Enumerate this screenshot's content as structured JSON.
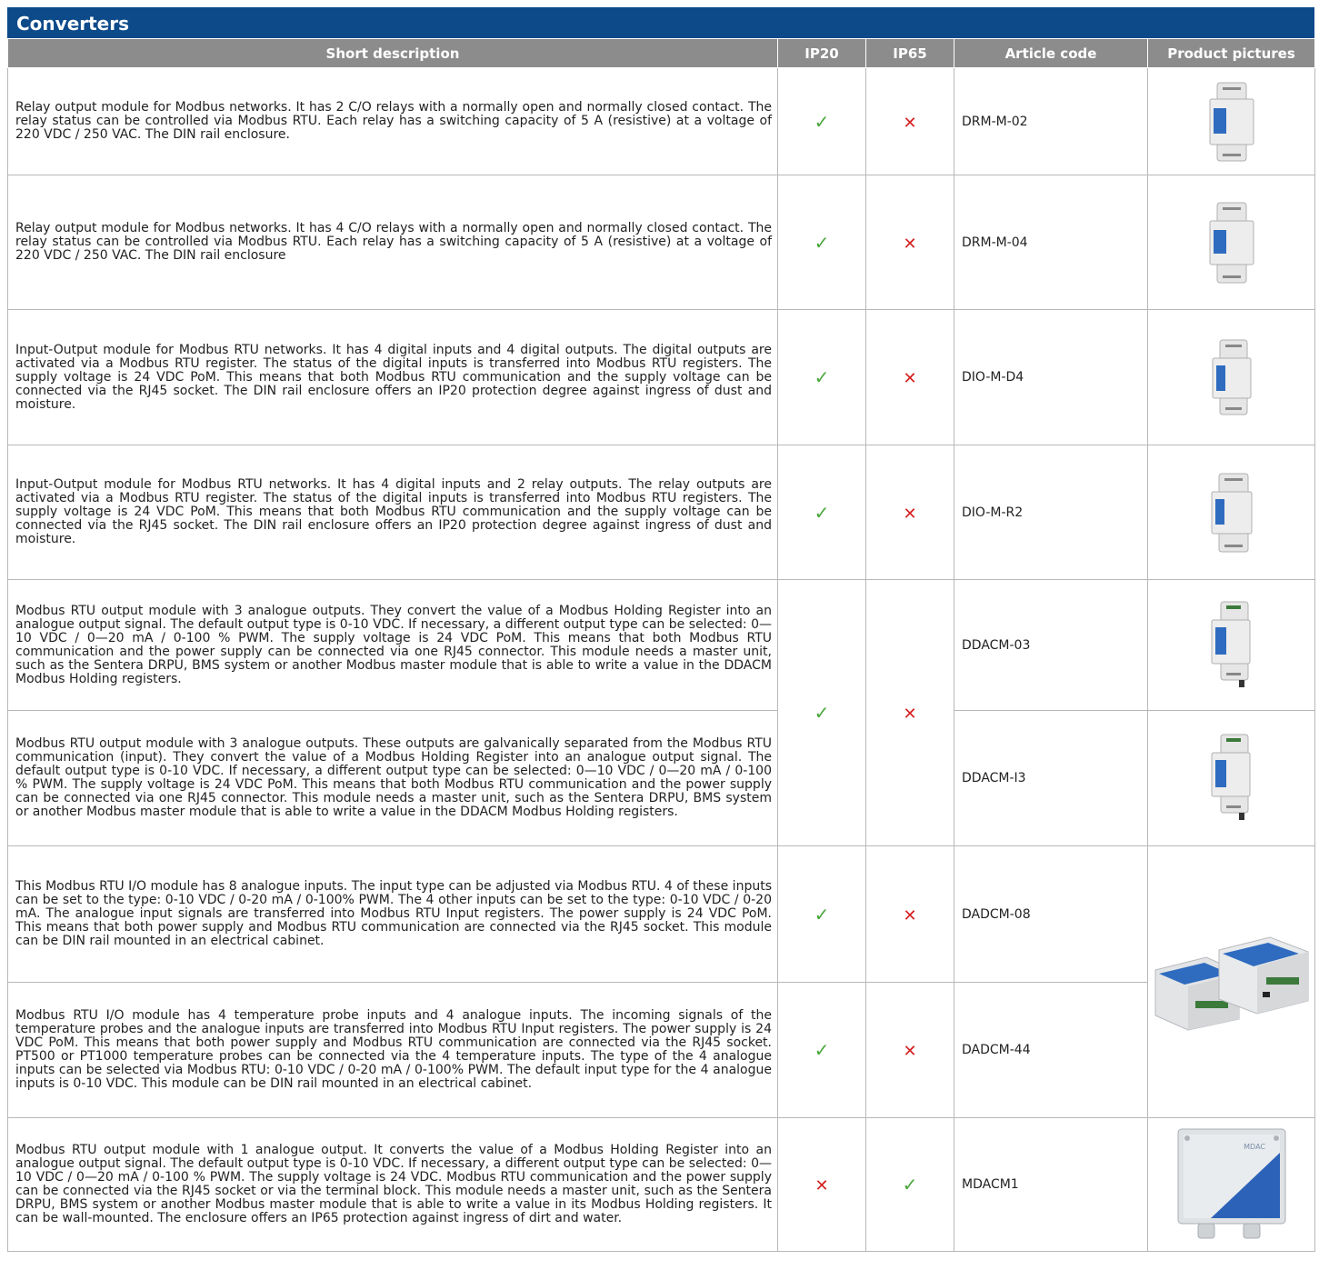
{
  "title": "Converters",
  "headers": {
    "desc": "Short description",
    "ip20": "IP20",
    "ip65": "IP65",
    "code": "Article code",
    "pictures": "Product pictures"
  },
  "symbols": {
    "check": "✓",
    "cross": "✕"
  },
  "colors": {
    "title_bg": "#0d4a8a",
    "header_bg": "#8c8c8c",
    "check": "#4aa63c",
    "cross": "#d62020"
  },
  "rows": [
    {
      "desc": "Relay output module for Modbus networks. It has 2 C/O relays with a normally open and normally closed contact. The relay status can be controlled via Modbus RTU. Each relay has a switching capacity of 5 A (resistive) at a voltage of 220 VDC / 250 VAC. The DIN rail enclosure.",
      "ip20": "check",
      "ip65": "cross",
      "code": "DRM-M-02",
      "picture": "din-rail-relay-module-picture"
    },
    {
      "desc": "Relay output module for Modbus networks. It has 4 C/O relays with a normally open and normally closed contact. The relay status can be controlled via Modbus RTU. Each relay has a switching capacity of 5 A (resistive) at a voltage of 220 VDC / 250 VAC. The DIN rail enclosure",
      "ip20": "check",
      "ip65": "cross",
      "code": "DRM-M-04",
      "picture": "din-rail-relay-module-picture"
    },
    {
      "desc": "Input-Output module for Modbus RTU networks. It has 4 digital inputs and 4 digital outputs. The digital outputs are activated via a Modbus RTU register. The status of the digital inputs is transferred into Modbus RTU registers. The supply voltage is 24 VDC PoM. This means that both Modbus RTU communication and the supply voltage can be connected via the RJ45 socket. The DIN rail enclosure offers an IP20 protection degree against ingress of dust and moisture.",
      "ip20": "check",
      "ip65": "cross",
      "code": "DIO-M-D4",
      "picture": "din-rail-io-module-picture"
    },
    {
      "desc": "Input-Output module for Modbus RTU networks. It has 4 digital inputs and 2 relay outputs. The relay outputs are activated via a Modbus RTU register. The status of the digital inputs is transferred into Modbus RTU registers. The supply voltage is 24 VDC PoM. This means that both Modbus RTU communication and the supply voltage can be connected via the RJ45 socket. The DIN rail enclosure offers an IP20 protection degree against ingress of dust and moisture.",
      "ip20": "check",
      "ip65": "cross",
      "code": "DIO-M-R2",
      "picture": "din-rail-io-module-picture"
    },
    {
      "desc": "Modbus RTU output module with 3 analogue outputs. They convert the value of a Modbus Holding Register into an analogue output signal. The default output type is 0-10 VDC. If necessary, a different output type can be selected: 0—10 VDC / 0—20 mA / 0-100 % PWM. The supply voltage is 24 VDC PoM. This means that both Modbus RTU communication and the power supply can be connected via one RJ45 connector. This module needs a master unit, such as the Sentera DRPU, BMS system or another Modbus master module that is able to write a value in the DDACM Modbus Holding registers.",
      "code": "DDACM-03",
      "picture": "din-rail-analogue-module-picture"
    },
    {
      "desc": "Modbus RTU output module with 3 analogue outputs. These outputs are galvanically separated from the Modbus RTU communication (input). They convert the value of a Modbus Holding Register into an analogue output signal. The default output type is 0-10 VDC. If necessary, a different output type can be selected: 0—10 VDC / 0—20 mA / 0-100 % PWM. The supply voltage is 24 VDC PoM. This means that both Modbus RTU communication and the power supply can be connected via one RJ45 connector. This module needs a master unit, such as the Sentera DRPU, BMS system or another Modbus master module that is able to write a value in the DDACM Modbus Holding registers.",
      "code": "DDACM-I3",
      "picture": "din-rail-analogue-module-picture"
    },
    {
      "desc": "This Modbus RTU I/O module has 8 analogue inputs. The input type can be adjusted via Modbus RTU. 4 of these inputs can be set to the type: 0-10 VDC / 0-20 mA / 0-100% PWM. The 4 other inputs can be set to the type: 0-10 VDC / 0-20 mA. The analogue input signals are transferred into Modbus RTU Input registers. The power supply is 24 VDC PoM. This means that both power supply and Modbus RTU communication are connected via the RJ45 socket. This module can be DIN rail mounted in an electrical cabinet.",
      "ip20": "check",
      "ip65": "cross",
      "code": "DADCM-08"
    },
    {
      "desc": "Modbus RTU I/O module has 4 temperature probe inputs and 4 analogue inputs. The incoming signals of the temperature probes and the analogue inputs are transferred into Modbus RTU Input registers. The power supply is 24 VDC PoM. This means that both power supply and Modbus RTU communication are connected via the RJ45 socket. PT500 or PT1000 temperature probes can be connected via the 4 temperature inputs. The type of the 4 analogue inputs can be selected via Modbus RTU: 0-10 VDC / 0-20 mA / 0-100% PWM. The default input type for the 4 analogue inputs is 0-10 VDC. This module can be DIN rail mounted in an electrical cabinet.",
      "ip20": "check",
      "ip65": "cross",
      "code": "DADCM-44"
    },
    {
      "desc": "Modbus RTU output module with 1 analogue output. It converts the value of a Modbus Holding Register into an analogue output signal. The default output type is 0-10 VDC. If necessary, a different output type can be selected: 0—10 VDC / 0—20 mA / 0-100 % PWM. The supply voltage is 24 VDC. Modbus RTU communication and the power supply can be connected via the RJ45 socket or via the terminal block. This module needs a master unit, such as the Sentera DRPU, BMS system or another Modbus master module that is able to write a value in its Modbus Holding registers. It can be wall-mounted. The enclosure offers an IP65 protection against ingress of dirt and water.",
      "ip20": "cross",
      "ip65": "check",
      "code": "MDACM1",
      "picture": "wall-mounted-enclosure-picture",
      "picture_label": "MDAC"
    }
  ],
  "merged": {
    "ddacm": {
      "ip20": "check",
      "ip65": "cross"
    },
    "dadcm_picture": "dadcm-modules-pair-picture"
  }
}
